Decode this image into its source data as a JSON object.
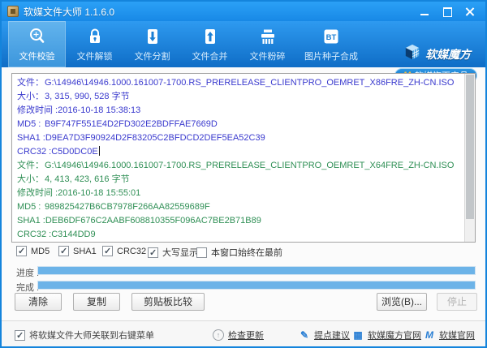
{
  "window": {
    "title": "软媒文件大师 1.1.6.0"
  },
  "toolbar": {
    "items": [
      {
        "label": "文件校验",
        "active": true
      },
      {
        "label": "文件解锁",
        "active": false
      },
      {
        "label": "文件分割",
        "active": false
      },
      {
        "label": "文件合并",
        "active": false
      },
      {
        "label": "文件粉碎",
        "active": false
      },
      {
        "label": "图片种子合成",
        "active": false,
        "badge": "BT"
      }
    ],
    "brand": {
      "name": "软媒魔方",
      "badge_logo": "M",
      "badge": "软媒旗下产品"
    }
  },
  "results": {
    "blocks": [
      {
        "color": "#3a3ace",
        "lines": [
          {
            "label": "文件：",
            "value": "G:\\14946\\14946.1000.161007-1700.RS_PRERELEASE_CLIENTPRO_OEMRET_X86FRE_ZH-CN.ISO"
          },
          {
            "label": "大小：",
            "value": "3, 315, 990, 528 字节"
          },
          {
            "label": "修改时间 :",
            "value": "2016-10-18 15:38:13"
          },
          {
            "label": "MD5 :",
            "value": "B9F747F551E4D2FD302E2BDFFAE7669D"
          },
          {
            "label": "SHA1 :",
            "value": "D9EA7D3F90924D2F83205C2BFDCD2DEF5EA52C39"
          },
          {
            "label": "CRC32 :",
            "value": "C5D0DC0E"
          }
        ]
      },
      {
        "color": "#2f8f55",
        "lines": [
          {
            "label": "文件：",
            "value": "G:\\14946\\14946.1000.161007-1700.RS_PRERELEASE_CLIENTPRO_OEMRET_X64FRE_ZH-CN.ISO"
          },
          {
            "label": "大小：",
            "value": "4, 413, 423, 616 字节"
          },
          {
            "label": "修改时间 :",
            "value": "2016-10-18 15:55:01"
          },
          {
            "label": "MD5 :",
            "value": "989825427B6CB7978F266AA82559689F"
          },
          {
            "label": "SHA1 :",
            "value": "DEB6DF676C2AABF608810355F096AC7BE2B71B89"
          },
          {
            "label": "CRC32 :",
            "value": "C3144DD9"
          }
        ]
      }
    ]
  },
  "options": [
    {
      "label": "MD5",
      "checked": true
    },
    {
      "label": "SHA1",
      "checked": true
    },
    {
      "label": "CRC32",
      "checked": true
    },
    {
      "label": "大写显示",
      "checked": true
    },
    {
      "label": "本窗口始终在最前",
      "checked": false
    }
  ],
  "progress": [
    {
      "label": "进度 :",
      "percent": 100
    },
    {
      "label": "完成 :",
      "percent": 100
    }
  ],
  "buttons": {
    "clear": "清除",
    "copy": "复制",
    "clipboard_compare": "剪贴板比较",
    "browse": "浏览(B)...",
    "stop": "停止"
  },
  "footer": {
    "associate": {
      "label": "将软媒文件大师关联到右键菜单",
      "checked": true
    },
    "links": [
      {
        "label": "检查更新",
        "glyph": "↑"
      },
      {
        "label": "提点建议",
        "glyph": "✎"
      },
      {
        "label": "软媒魔方官网",
        "glyph": "▦"
      },
      {
        "label": "软媒官网",
        "glyph": "M"
      }
    ]
  },
  "colors": {
    "accent": "#1484dc",
    "toolbar_top": "#2e9af0",
    "toolbar_bottom": "#0f6dc6",
    "progress_fill": "#6cb3e8",
    "block1_text": "#3a3ace",
    "block2_text": "#2f8f55"
  }
}
